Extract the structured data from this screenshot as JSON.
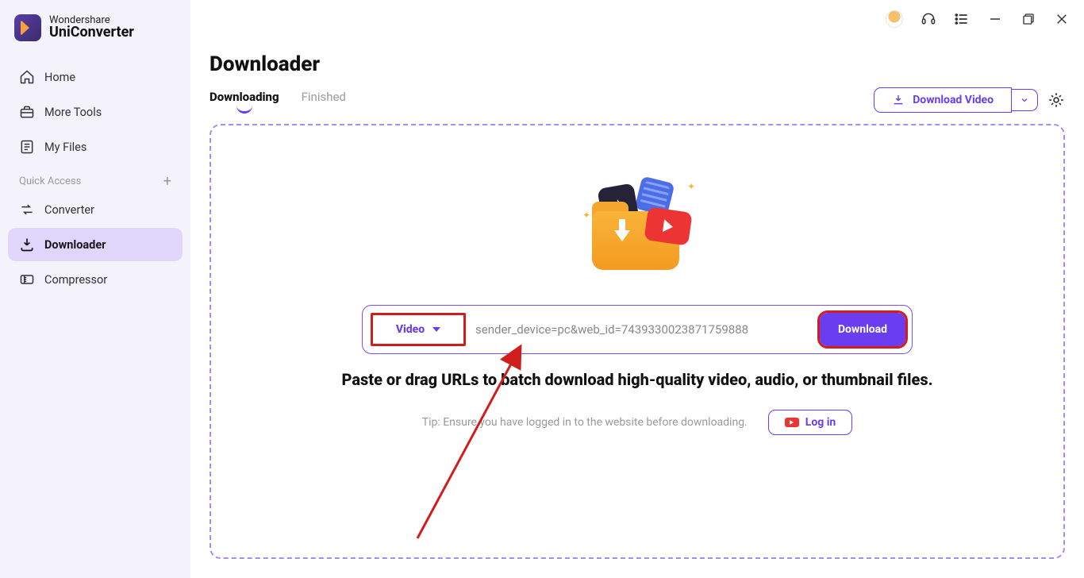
{
  "brand": {
    "line1": "Wondershare",
    "line2": "UniConverter"
  },
  "sidebar": {
    "items": [
      {
        "label": "Home"
      },
      {
        "label": "More Tools"
      },
      {
        "label": "My Files"
      }
    ],
    "quick_access_label": "Quick Access",
    "quick_items": [
      {
        "label": "Converter"
      },
      {
        "label": "Downloader"
      },
      {
        "label": "Compressor"
      }
    ]
  },
  "page": {
    "title": "Downloader"
  },
  "tabs": [
    {
      "label": "Downloading",
      "active": true
    },
    {
      "label": "Finished",
      "active": false
    }
  ],
  "actions": {
    "download_video_label": "Download Video"
  },
  "urlbar": {
    "type_label": "Video",
    "input_value": "sender_device=pc&web_id=7439330023871759888",
    "download_label": "Download"
  },
  "prompt": "Paste or drag URLs to batch download high-quality video, audio, or thumbnail files.",
  "tip": "Tip: Ensure you have logged in to the website before downloading.",
  "login_label": "Log in",
  "colors": {
    "accent": "#6a3df0",
    "annotation": "#d21d1d"
  }
}
